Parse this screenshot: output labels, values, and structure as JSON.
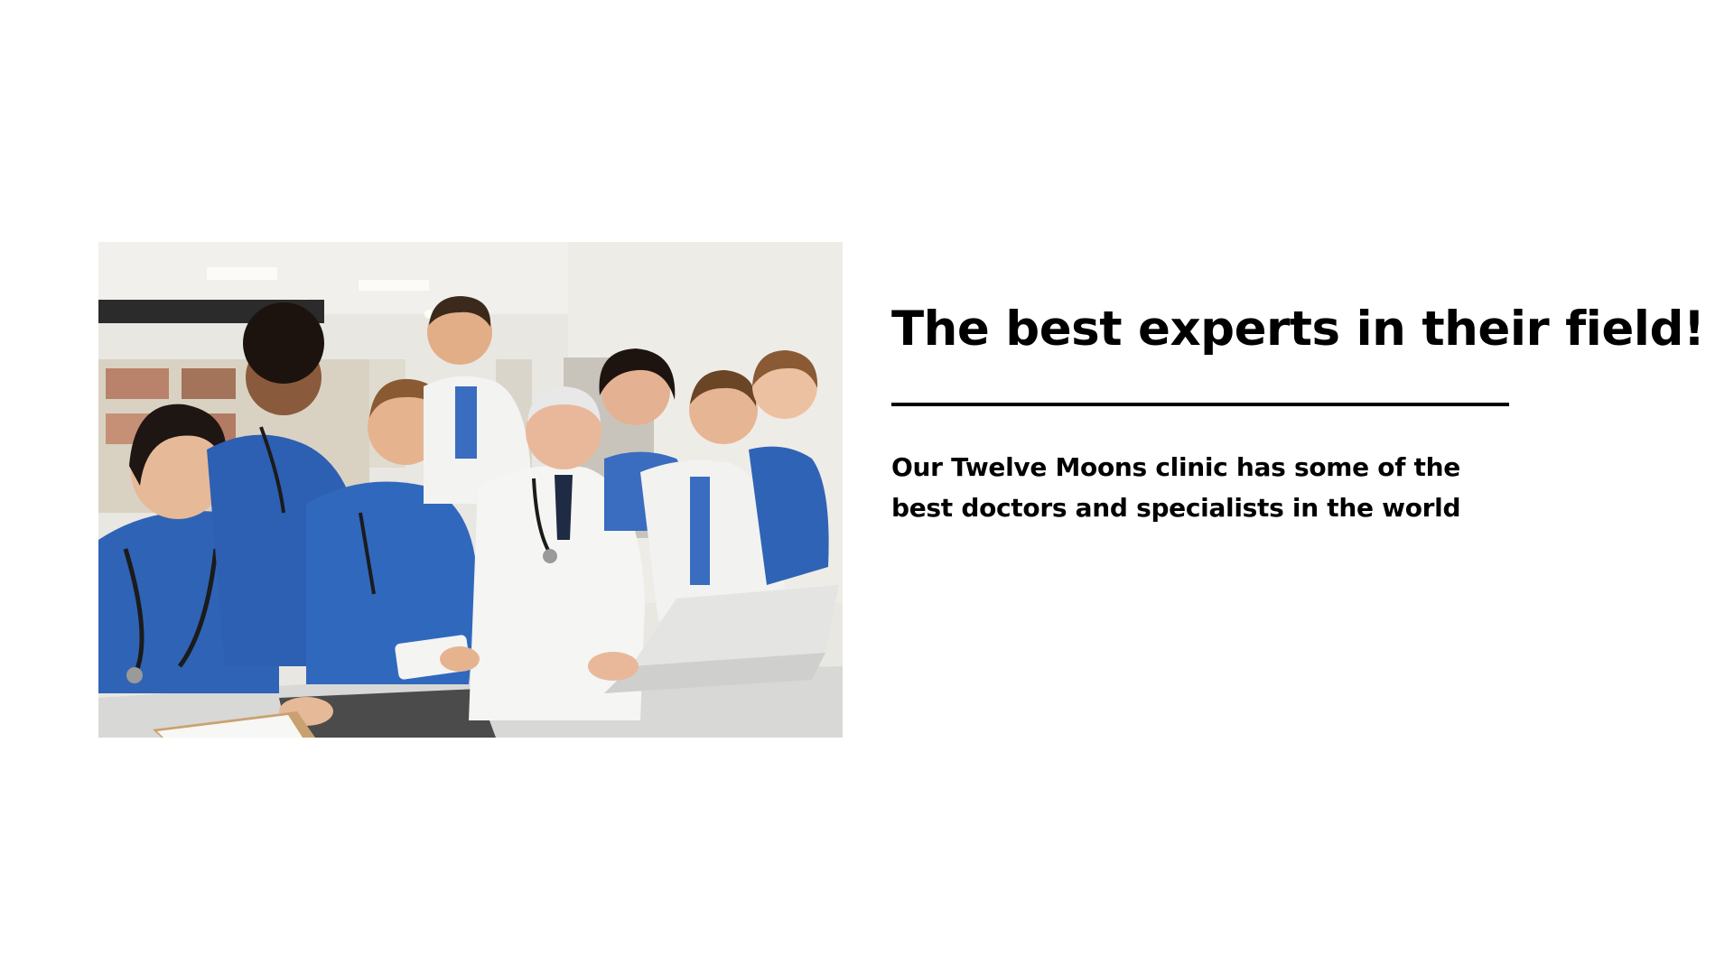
{
  "slide": {
    "headline": "The best experts in their field!",
    "body": "Our Twelve Moons clinic has some of the best doctors and specialists in the world",
    "photo_subject": "team-of-doctors-photo"
  },
  "colors": {
    "background": "#ffffff",
    "text": "#000000",
    "divider": "#000000",
    "scrubs": "#2f63b5",
    "coat": "#f2f2f2"
  }
}
